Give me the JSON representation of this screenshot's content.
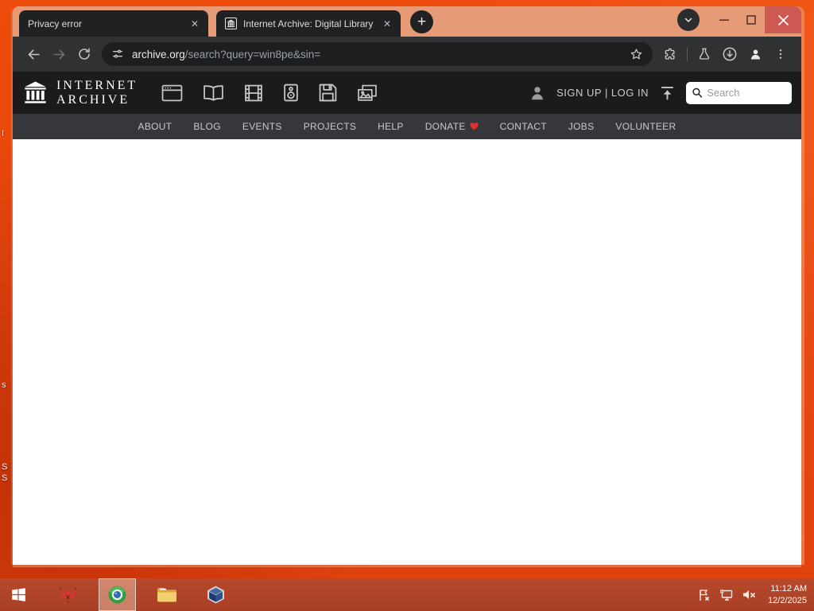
{
  "desktop": {
    "icon_fragments": {
      "f1": "I",
      "f2": "s",
      "f3": "S",
      "f4": "S"
    }
  },
  "browser": {
    "tabs": {
      "tab1": {
        "title": "Privacy error"
      },
      "tab2": {
        "title": "Internet Archive: Digital Library"
      }
    },
    "close_glyph": "✕",
    "new_tab_glyph": "+",
    "url": {
      "domain": "archive.org",
      "path": "/search?query=win8pe&sin="
    }
  },
  "archive": {
    "logo_line1": "INTERNET",
    "logo_line2": "ARCHIVE",
    "auth_label": "SIGN UP | LOG IN",
    "search_placeholder": "Search",
    "nav": {
      "about": "ABOUT",
      "blog": "BLOG",
      "events": "EVENTS",
      "projects": "PROJECTS",
      "help": "HELP",
      "donate": "DONATE",
      "contact": "CONTACT",
      "jobs": "JOBS",
      "volunteer": "VOLUNTEER"
    }
  },
  "taskbar": {
    "clock_time": "11:12 AM",
    "clock_date": "12/2/2025"
  },
  "colors": {
    "desktop_orange": "#e5440e",
    "titlebar_salmon": "#e69a76",
    "taskbar_red": "#ad4126",
    "donate_heart": "#e03131",
    "close_button_red": "#cd5a52"
  }
}
